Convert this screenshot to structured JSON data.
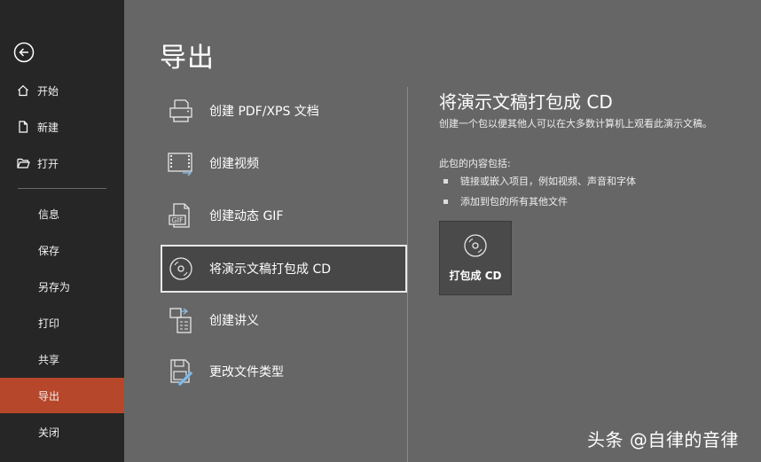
{
  "sidebar": {
    "items": [
      {
        "label": "开始",
        "icon": "home-icon"
      },
      {
        "label": "新建",
        "icon": "new-document-icon"
      },
      {
        "label": "打开",
        "icon": "folder-open-icon"
      },
      {
        "label": "信息"
      },
      {
        "label": "保存"
      },
      {
        "label": "另存为"
      },
      {
        "label": "打印"
      },
      {
        "label": "共享"
      },
      {
        "label": "导出",
        "active": true
      },
      {
        "label": "关闭"
      }
    ],
    "active_color": "#b7472a"
  },
  "main": {
    "title": "导出",
    "options": [
      {
        "label": "创建 PDF/XPS 文档",
        "icon": "pdf-xps-icon"
      },
      {
        "label": "创建视频",
        "icon": "video-icon"
      },
      {
        "label": "创建动态 GIF",
        "icon": "gif-icon"
      },
      {
        "label": "将演示文稿打包成 CD",
        "icon": "cd-icon",
        "selected": true
      },
      {
        "label": "创建讲义",
        "icon": "handouts-icon"
      },
      {
        "label": "更改文件类型",
        "icon": "change-file-type-icon"
      }
    ]
  },
  "detail": {
    "title": "将演示文稿打包成 CD",
    "description": "创建一个包以便其他人可以在大多数计算机上观看此演示文稿。",
    "contents_heading": "此包的内容包括:",
    "bullets": [
      "链接或嵌入项目，例如视频、声音和字体",
      "添加到包的所有其他文件"
    ],
    "button_label": "打包成 CD"
  },
  "watermark": "头条 @自律的音律"
}
